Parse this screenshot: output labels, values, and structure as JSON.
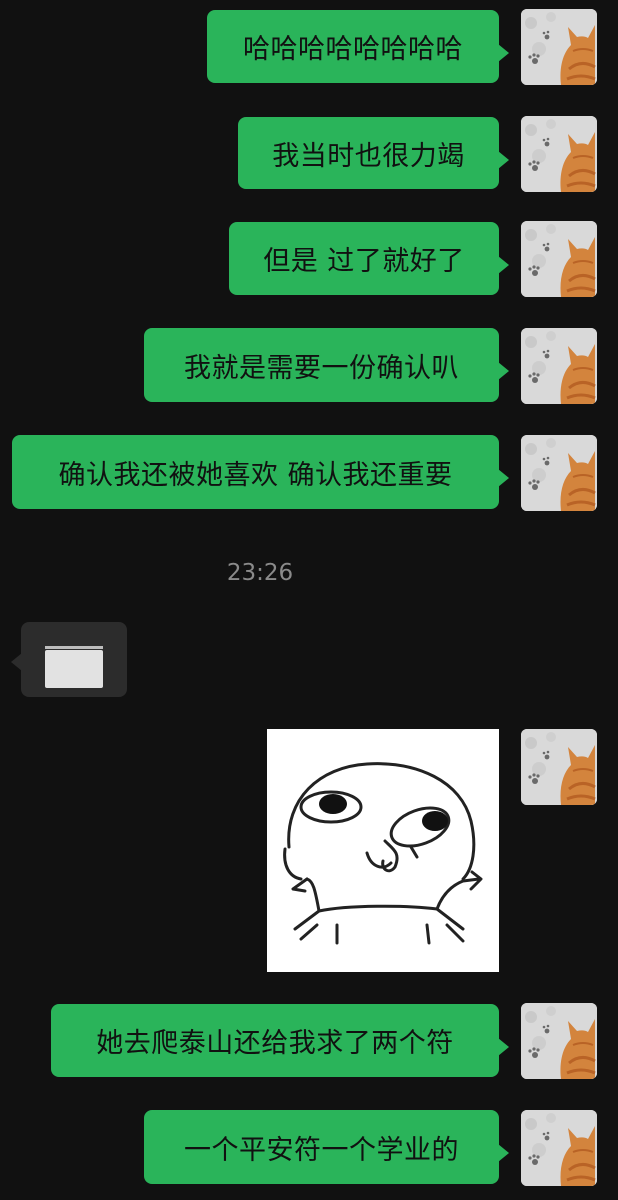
{
  "messages": [
    {
      "text": "哈哈哈哈哈哈哈哈"
    },
    {
      "text": "我当时也很力竭"
    },
    {
      "text": "但是 过了就好了"
    },
    {
      "text": "我就是需要一份确认叭"
    },
    {
      "text": "确认我还被她喜欢 确认我还重要"
    },
    {
      "text": "她去爬泰山还给我求了两个符"
    },
    {
      "text": "一个平安符一个学业的"
    }
  ],
  "timestamp": "23:26",
  "colors": {
    "background": "#111111",
    "outgoing_bubble": "#2ab45a",
    "incoming_bubble": "#2c2c2c",
    "timestamp_text": "#8a8a8a"
  },
  "icons": {
    "avatar": "cat-avatar-icon",
    "sticker": "doodle-face-sticker"
  }
}
